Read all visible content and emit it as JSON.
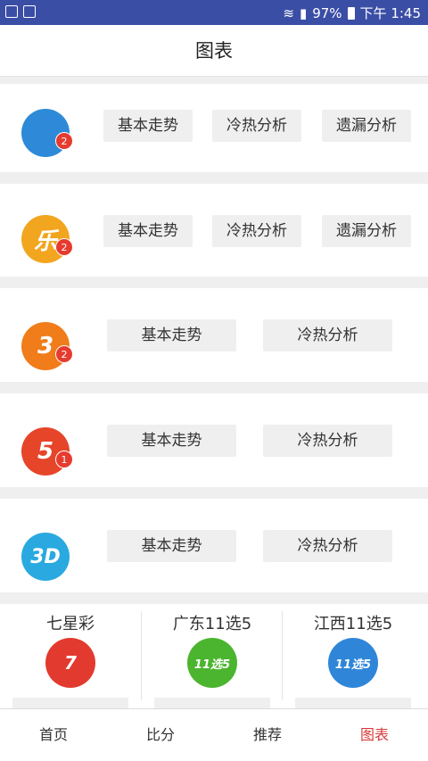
{
  "status_bar": {
    "battery": "97%",
    "time": "下午 1:45",
    "icons": [
      "image-icon",
      "checkbox-icon",
      "wifi-icon",
      "signal-icon",
      "battery-icon"
    ]
  },
  "header": {
    "title": "图表"
  },
  "cards": [
    {
      "ball_text": "",
      "ball_color": "#2e8ad8",
      "buttons": [
        "基本走势",
        "冷热分析",
        "遗漏分析"
      ]
    },
    {
      "ball_text": "乐",
      "ball_color": "#f2a51f",
      "buttons": [
        "基本走势",
        "冷热分析",
        "遗漏分析"
      ]
    },
    {
      "ball_text": "3",
      "ball_color": "#f07c1a",
      "buttons": [
        "基本走势",
        "冷热分析"
      ]
    },
    {
      "ball_text": "5",
      "ball_color": "#e6452a",
      "buttons": [
        "基本走势",
        "冷热分析"
      ]
    },
    {
      "ball_text": "3D",
      "ball_color": "#29a9e0",
      "buttons": [
        "基本走势",
        "冷热分析"
      ]
    }
  ],
  "bottom_games": [
    {
      "name": "七星彩",
      "icon_text": "7",
      "icon_color": "#e23a2e"
    },
    {
      "name": "广东11选5",
      "icon_text": "11选5",
      "icon_color": "#4cb52f"
    },
    {
      "name": "江西11选5",
      "icon_text": "11选5",
      "icon_color": "#2f86d9"
    }
  ],
  "tabbar": {
    "tabs": [
      "首页",
      "比分",
      "推荐",
      "图表"
    ],
    "active_color": "#d93a3a"
  },
  "colors": {
    "status_bar": "#3b4ea6",
    "background": "#efefef"
  }
}
